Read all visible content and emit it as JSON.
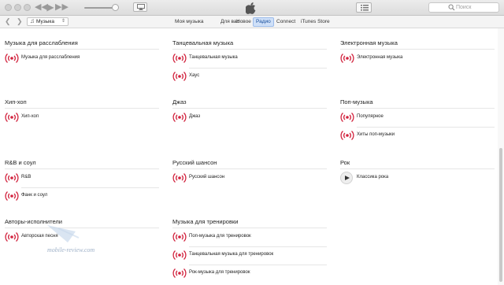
{
  "search": {
    "placeholder": "Поиск"
  },
  "media_picker": {
    "label": "Музыка"
  },
  "tabs": [
    {
      "label": "Моя музыка"
    },
    {
      "label": "Для вас"
    },
    {
      "label": "Новое"
    },
    {
      "label": "Радио",
      "selected": true
    },
    {
      "label": "Connect"
    },
    {
      "label": "iTunes Store"
    }
  ],
  "genres": [
    {
      "title": "Музыка для расслабления",
      "stations": [
        {
          "label": "Музыка для расслабления"
        }
      ]
    },
    {
      "title": "Танцевальная музыка",
      "stations": [
        {
          "label": "Танцевальная музыка"
        },
        {
          "label": "Хаус"
        }
      ]
    },
    {
      "title": "Электронная музыка",
      "stations": [
        {
          "label": "Электронная музыка"
        }
      ]
    },
    {
      "title": "Хип-хоп",
      "stations": [
        {
          "label": "Хип-хоп"
        }
      ]
    },
    {
      "title": "Джаз",
      "stations": [
        {
          "label": "Джаз"
        }
      ]
    },
    {
      "title": "Поп-музыка",
      "stations": [
        {
          "label": "Популярное"
        },
        {
          "label": "Хиты поп-музыки"
        }
      ]
    },
    {
      "title": "R&B и соул",
      "stations": [
        {
          "label": "R&B"
        },
        {
          "label": "Фанк и соул"
        }
      ]
    },
    {
      "title": "Русский шансон",
      "stations": [
        {
          "label": "Русский шансон"
        }
      ]
    },
    {
      "title": "Рок",
      "stations": [
        {
          "label": "Классика рока",
          "playing": true
        }
      ]
    },
    {
      "title": "Авторы-исполнители",
      "stations": [
        {
          "label": "Авторская песня"
        }
      ]
    },
    {
      "title": "Музыка для тренировки",
      "stations": [
        {
          "label": "Поп-музыка для тренировок"
        },
        {
          "label": "Танцевальная музыка для тренировок"
        },
        {
          "label": "Рок-музыка для тренировок"
        }
      ]
    }
  ],
  "watermark": {
    "text": "mobile-review.com"
  },
  "colors": {
    "accent": "#d2233e",
    "selected_tab": "#cfe0f8"
  }
}
